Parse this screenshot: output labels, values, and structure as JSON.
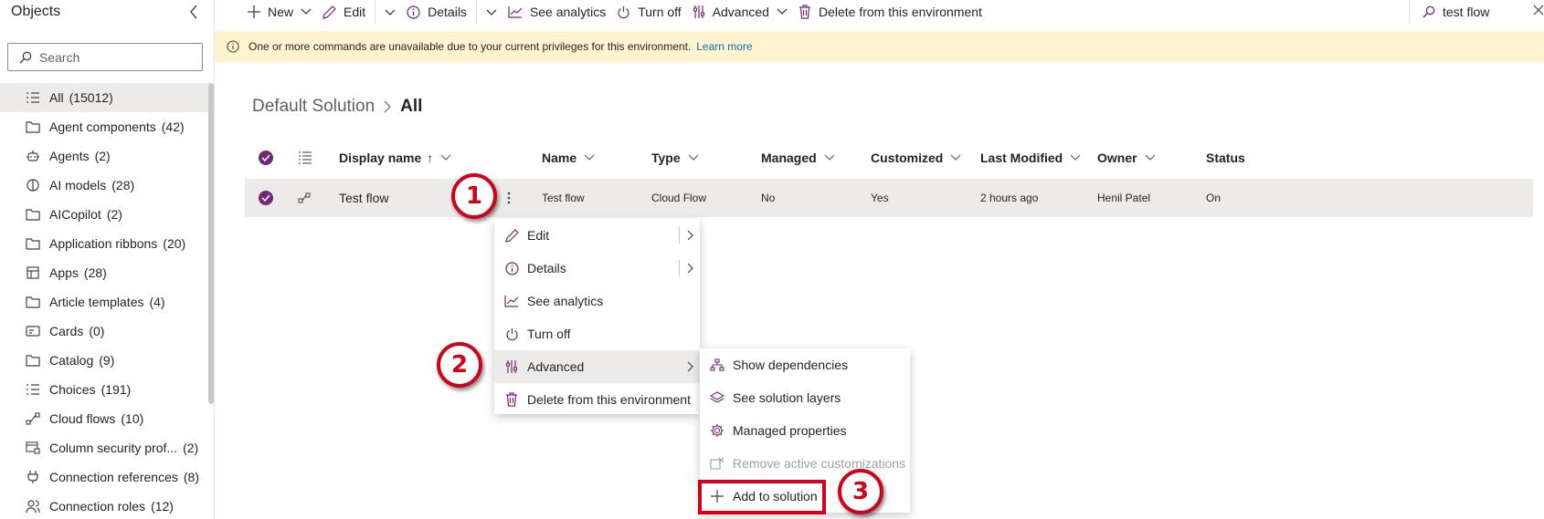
{
  "sidebar": {
    "title": "Objects",
    "search_placeholder": "Search",
    "items": [
      {
        "label": "All",
        "count": "(15012)",
        "icon": "list-icon"
      },
      {
        "label": "Agent components",
        "count": "(42)",
        "icon": "folder-icon"
      },
      {
        "label": "Agents",
        "count": "(2)",
        "icon": "bot-icon"
      },
      {
        "label": "AI models",
        "count": "(28)",
        "icon": "brain-icon"
      },
      {
        "label": "AICopilot",
        "count": "(2)",
        "icon": "folder-icon"
      },
      {
        "label": "Application ribbons",
        "count": "(20)",
        "icon": "folder-icon"
      },
      {
        "label": "Apps",
        "count": "(28)",
        "icon": "grid-icon"
      },
      {
        "label": "Article templates",
        "count": "(4)",
        "icon": "folder-icon"
      },
      {
        "label": "Cards",
        "count": "(0)",
        "icon": "card-icon"
      },
      {
        "label": "Catalog",
        "count": "(9)",
        "icon": "folder-icon"
      },
      {
        "label": "Choices",
        "count": "(191)",
        "icon": "list-icon"
      },
      {
        "label": "Cloud flows",
        "count": "(10)",
        "icon": "flow-icon"
      },
      {
        "label": "Column security prof...",
        "count": "(2)",
        "icon": "column-security-icon"
      },
      {
        "label": "Connection references",
        "count": "(8)",
        "icon": "plug-icon"
      },
      {
        "label": "Connection roles",
        "count": "(12)",
        "icon": "people-icon"
      }
    ]
  },
  "toolbar": {
    "new": "New",
    "edit": "Edit",
    "details": "Details",
    "see_analytics": "See analytics",
    "turn_off": "Turn off",
    "advanced": "Advanced",
    "delete": "Delete from this environment",
    "search_value": "test flow"
  },
  "warning": {
    "text": "One or more commands are unavailable due to your current privileges for this environment.",
    "link": "Learn more"
  },
  "breadcrumb": {
    "parent": "Default Solution",
    "current": "All"
  },
  "grid": {
    "columns": {
      "display_name": "Display name",
      "sort_indicator": "↑",
      "name": "Name",
      "type": "Type",
      "managed": "Managed",
      "customized": "Customized",
      "last_modified": "Last Modified",
      "owner": "Owner",
      "status": "Status"
    },
    "rows": [
      {
        "display_name": "Test flow",
        "name": "Test flow",
        "type": "Cloud Flow",
        "managed": "No",
        "customized": "Yes",
        "last_modified": "2 hours ago",
        "owner": "Henil Patel",
        "status": "On"
      }
    ]
  },
  "context_menu": {
    "items": [
      {
        "label": "Edit",
        "icon": "pencil-icon"
      },
      {
        "label": "Details",
        "icon": "info-icon"
      },
      {
        "label": "See analytics",
        "icon": "chart-icon"
      },
      {
        "label": "Turn off",
        "icon": "power-icon"
      },
      {
        "label": "Advanced",
        "icon": "advanced-icon"
      },
      {
        "label": "Delete from this environment",
        "icon": "trash-icon"
      }
    ]
  },
  "submenu": {
    "items": [
      {
        "label": "Show dependencies",
        "icon": "hierarchy-icon"
      },
      {
        "label": "See solution layers",
        "icon": "layers-icon"
      },
      {
        "label": "Managed properties",
        "icon": "gear-icon"
      },
      {
        "label": "Remove active customizations",
        "icon": "remove-icon",
        "disabled": true
      },
      {
        "label": "Add to solution",
        "icon": "plus-icon"
      }
    ]
  },
  "annotations": {
    "step1": "1",
    "step2": "2",
    "step3": "3",
    "color": "#d0021b"
  },
  "colors": {
    "accent": "#742774",
    "warning_bg": "#fff4ce",
    "link": "#0f6cbd",
    "selected_row": "#edebe9"
  }
}
